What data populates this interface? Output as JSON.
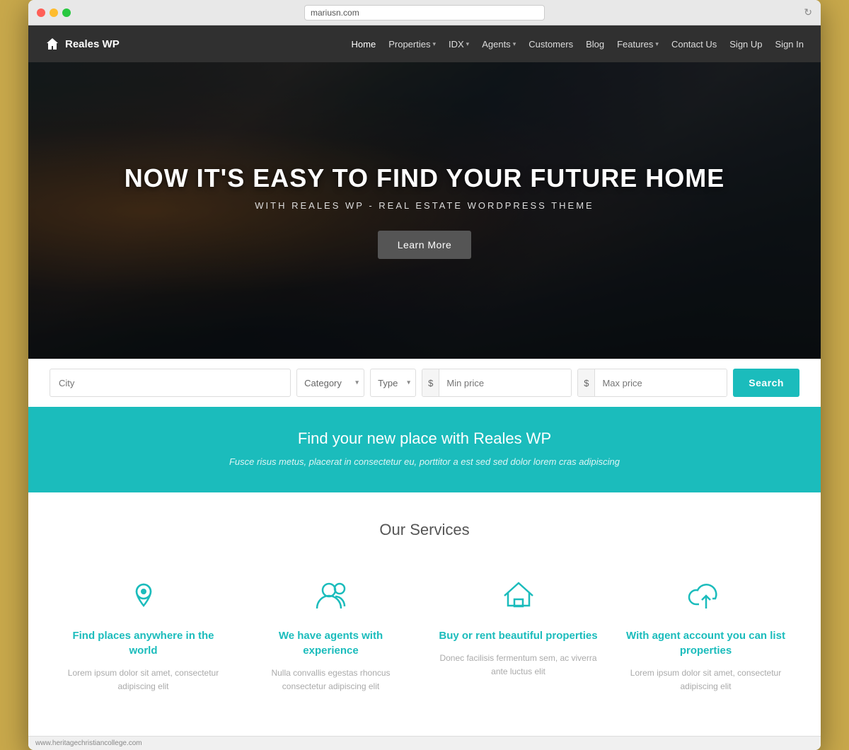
{
  "browser": {
    "url": "mariusn.com",
    "status_text": "www.heritagechristiancollege.com"
  },
  "nav": {
    "logo_text": "Reales WP",
    "links": [
      {
        "label": "Home",
        "has_dropdown": false
      },
      {
        "label": "Properties",
        "has_dropdown": true
      },
      {
        "label": "IDX",
        "has_dropdown": true
      },
      {
        "label": "Agents",
        "has_dropdown": true
      },
      {
        "label": "Customers",
        "has_dropdown": false
      },
      {
        "label": "Blog",
        "has_dropdown": false
      },
      {
        "label": "Features",
        "has_dropdown": true
      },
      {
        "label": "Contact Us",
        "has_dropdown": false
      },
      {
        "label": "Sign Up",
        "has_dropdown": false
      },
      {
        "label": "Sign In",
        "has_dropdown": false
      }
    ]
  },
  "hero": {
    "title": "NOW IT'S EASY TO FIND YOUR FUTURE HOME",
    "subtitle": "WITH REALES WP - REAL ESTATE WORDPRESS THEME",
    "button_label": "Learn More"
  },
  "search": {
    "city_placeholder": "City",
    "category_label": "Category",
    "type_label": "Type",
    "min_price_placeholder": "Min price",
    "max_price_placeholder": "Max price",
    "button_label": "Search",
    "currency_symbol": "$"
  },
  "teal_banner": {
    "title": "Find your new place with Reales WP",
    "text": "Fusce risus metus, placerat in consectetur eu, porttitor a est sed sed dolor lorem cras adipiscing"
  },
  "services": {
    "section_title": "Our Services",
    "items": [
      {
        "name": "Find places anywhere in the world",
        "description": "Lorem ipsum dolor sit amet, consectetur adipiscing elit",
        "icon": "location"
      },
      {
        "name": "We have agents with experience",
        "description": "Nulla convallis egestas rhoncus consectetur adipiscing elit",
        "icon": "person"
      },
      {
        "name": "Buy or rent beautiful properties",
        "description": "Donec facilisis fermentum sem, ac viverra ante luctus elit",
        "icon": "home"
      },
      {
        "name": "With agent account you can list properties",
        "description": "Lorem ipsum dolor sit amet, consectetur adipiscing elit",
        "icon": "cloud-upload"
      }
    ]
  }
}
